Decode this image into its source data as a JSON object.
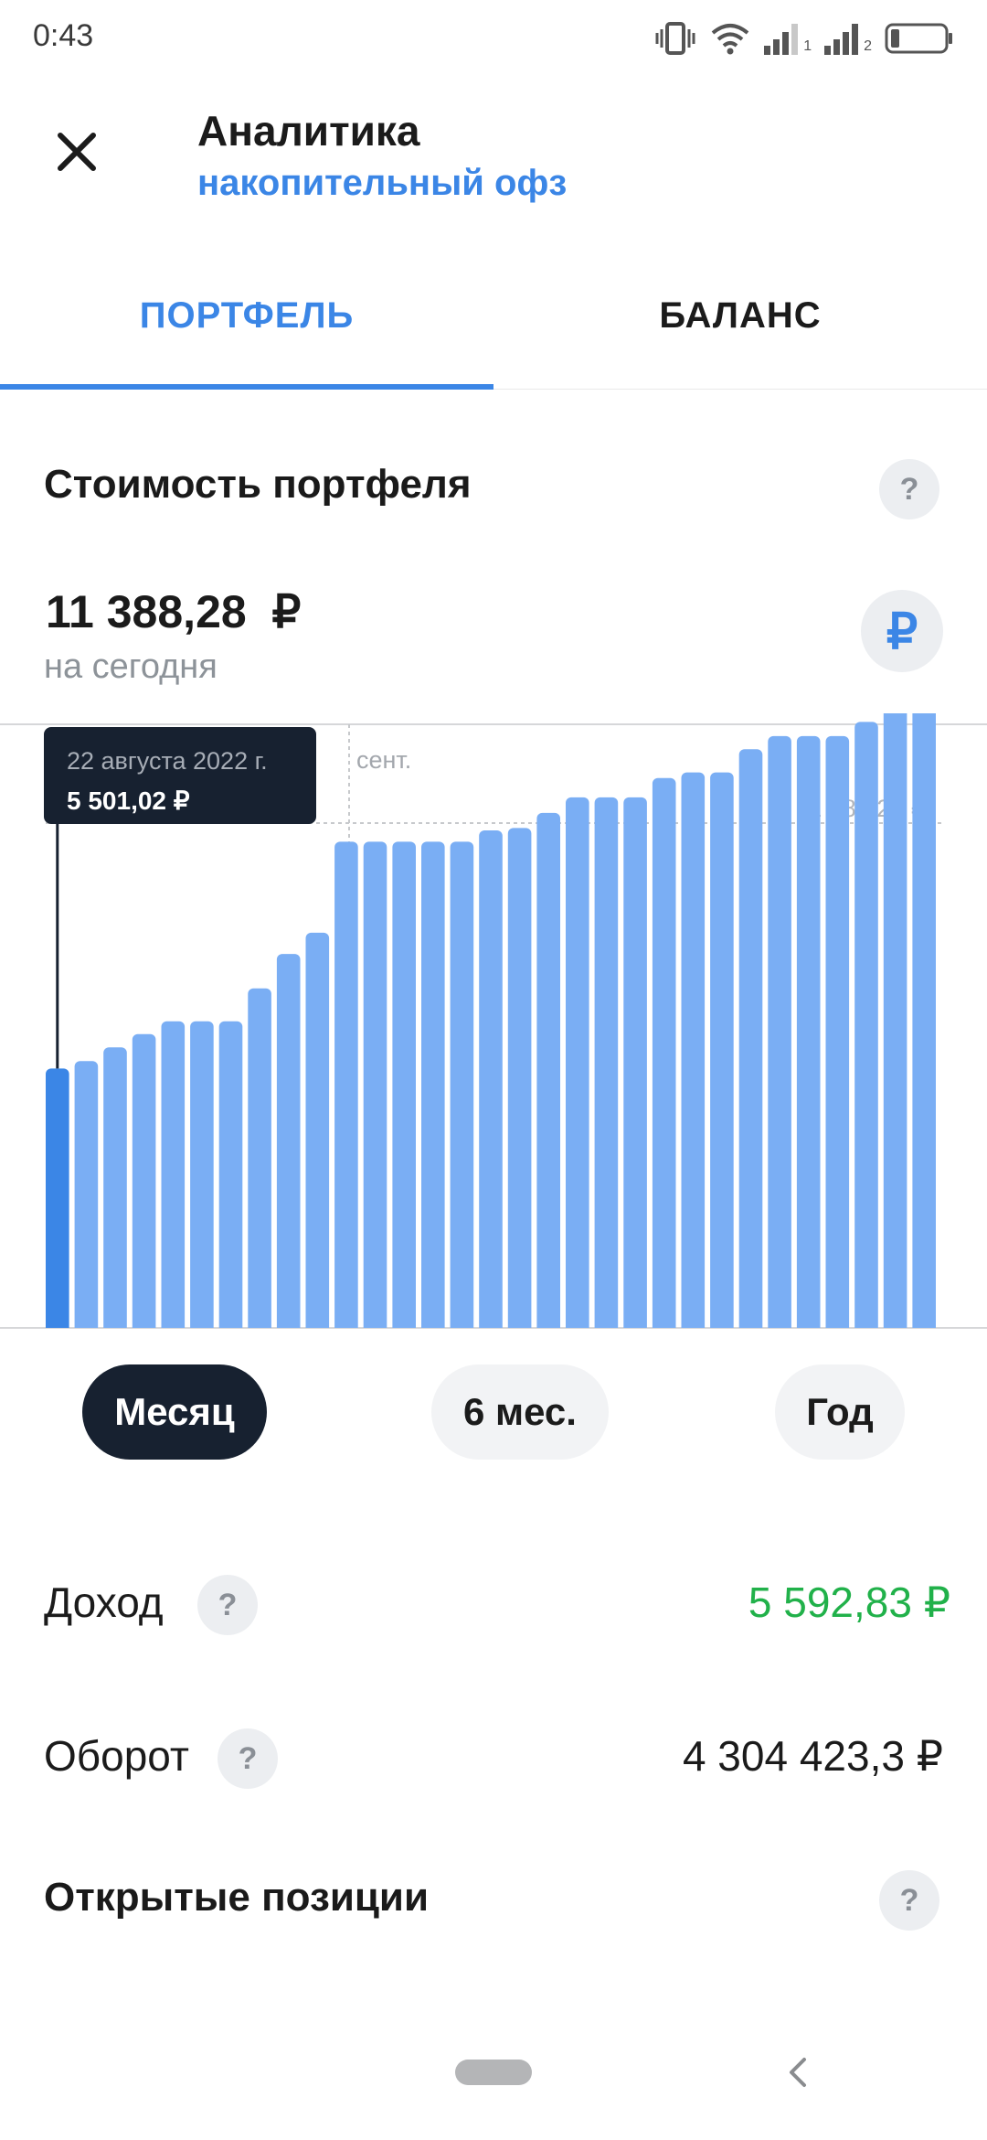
{
  "status_bar": {
    "time": "0:43",
    "icons": [
      "vibrate-icon",
      "wifi-icon",
      "signal-sim1-icon",
      "signal-sim2-icon",
      "battery-icon"
    ],
    "sim1": "1",
    "sim2": "2"
  },
  "header": {
    "close_icon": "close-icon",
    "title": "Аналитика",
    "subtitle": "накопительный офз"
  },
  "tabs": [
    {
      "label": "ПОРТФЕЛЬ",
      "active": true
    },
    {
      "label": "БАЛАНС",
      "active": false
    }
  ],
  "portfolio": {
    "section_title": "Стоимость портфеля",
    "help": "?",
    "amount": "11 388,28  ₽",
    "caption": "на сегодня",
    "currency_symbol": "₽"
  },
  "chart_data": {
    "type": "bar",
    "month_label": "сент.",
    "max_label": "11 388,29 ₽",
    "tooltip": {
      "date": "22 августа 2022 г.",
      "value": "5 501,02 ₽"
    },
    "selected_index": 0,
    "ylim": [
      0,
      12800
    ],
    "values": [
      5501,
      5660,
      5950,
      6230,
      6500,
      6500,
      6500,
      7200,
      7930,
      8380,
      10310,
      10310,
      10310,
      10310,
      10310,
      10550,
      10600,
      10920,
      11250,
      11250,
      11250,
      11660,
      11780,
      11780,
      12270,
      12550,
      12550,
      12550,
      12850,
      13600,
      13600
    ],
    "colors": {
      "bar": "#7aaef4",
      "selected": "#3b86e6",
      "guide": "#c7c9cc",
      "tooltip_bg": "#172130"
    }
  },
  "periods": [
    {
      "label": "Месяц",
      "active": true
    },
    {
      "label": "6 мес.",
      "active": false
    },
    {
      "label": "Год",
      "active": false
    }
  ],
  "stats": {
    "income_label": "Доход",
    "income_value": "5 592,83 ₽",
    "turnover_label": "Оборот",
    "turnover_value": "4 304 423,3 ₽",
    "help": "?"
  },
  "positions": {
    "title": "Открытые позиции",
    "help": "?"
  },
  "nav_bar": {
    "home_icon": "home-pill-icon",
    "back_icon": "back-chevron-icon"
  },
  "colors": {
    "accent": "#3b86e6",
    "income": "#21b14a",
    "dark": "#172130"
  }
}
